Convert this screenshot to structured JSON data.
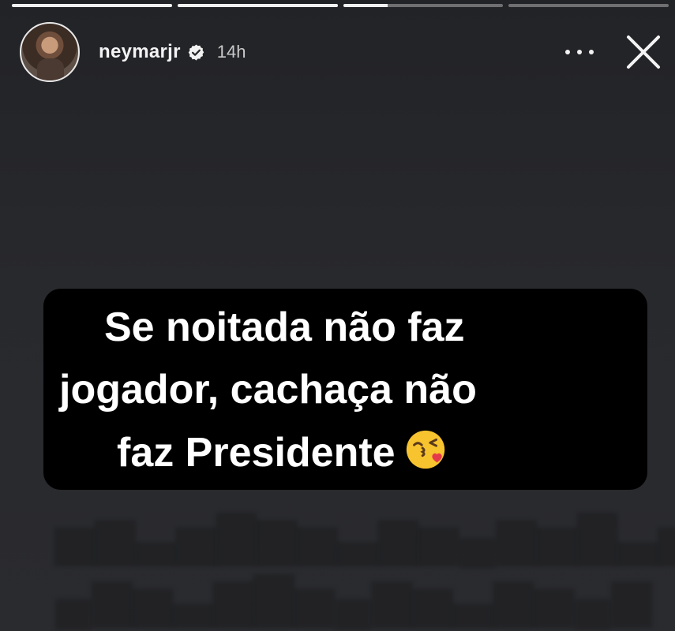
{
  "story": {
    "progress": [
      1,
      1,
      0.28,
      0
    ],
    "user": {
      "username": "neymarjr",
      "verified": true,
      "time_ago": "14h"
    },
    "icons": {
      "avatar": "profile-avatar",
      "verified": "verified-badge-icon",
      "more": "more-options-icon",
      "close": "close-icon",
      "emoji": "face-blowing-kiss-emoji"
    },
    "caption": {
      "lines": [
        "Se noitada não faz",
        "jogador, cachaça não",
        "faz Presidente"
      ],
      "emoji": "😘"
    },
    "colors": {
      "background": "#27282c",
      "caption_bg": "#000000",
      "text": "#ffffff"
    }
  }
}
